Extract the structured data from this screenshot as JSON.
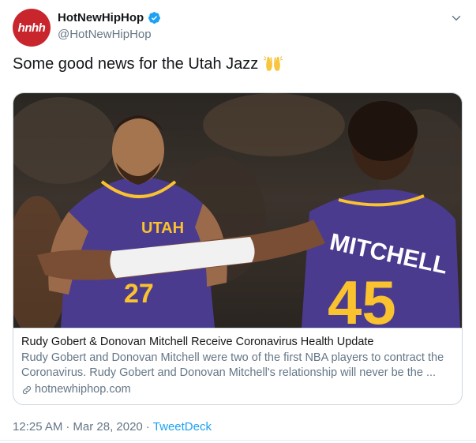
{
  "author": {
    "avatar_text": "hnhh",
    "display_name": "HotNewHipHop",
    "handle": "@HotNewHipHop",
    "verified": true
  },
  "tweet": {
    "text": "Some good news for the Utah Jazz",
    "emoji": "raised-hands-emoji"
  },
  "card": {
    "image": {
      "left_jersey_team": "UTAH",
      "left_jersey_number": "27",
      "right_jersey_name": "MITCHELL",
      "right_jersey_number": "45"
    },
    "title": "Rudy Gobert & Donovan Mitchell Receive Coronavirus Health Update",
    "description": "Rudy Gobert and Donovan Mitchell were two of the first NBA players to contract the Coronavirus. Rudy Gobert and Donovan Mitchell's relationship will never be the ...",
    "domain": "hotnewhiphop.com"
  },
  "meta": {
    "time": "12:25 AM",
    "separator": "·",
    "date": "Mar 28, 2020",
    "source": "TweetDeck"
  },
  "colors": {
    "avatar_bg": "#c8262c",
    "link_blue": "#1da1f2",
    "muted_text": "#657786",
    "jersey_purple": "#4b3b8f",
    "jersey_gold": "#f9c22e"
  }
}
